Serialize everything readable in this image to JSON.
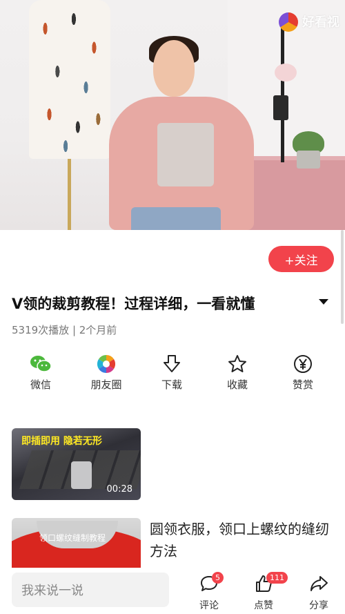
{
  "video": {
    "watermark_text": "好看视"
  },
  "follow_button": {
    "label": "+关注"
  },
  "video_info": {
    "title": "V领的裁剪教程！过程详细，一看就懂",
    "meta": "5319次播放 | 2个月前"
  },
  "share_actions": [
    {
      "label": "微信",
      "icon": "wechat-icon",
      "color": "#4cb83c"
    },
    {
      "label": "朋友圈",
      "icon": "moments-icon"
    },
    {
      "label": "下载",
      "icon": "download-icon"
    },
    {
      "label": "收藏",
      "icon": "favorite-star-icon"
    },
    {
      "label": "赞赏",
      "icon": "yen-icon"
    }
  ],
  "recommendations": [
    {
      "banner": "即插即用 隐若无形",
      "duration": "00:28",
      "title": ""
    },
    {
      "banner": "领口螺纹缝制教程",
      "title": "圆领衣服，领口上螺纹的缝纫方法"
    }
  ],
  "bottom_bar": {
    "comment_placeholder": "我来说一说",
    "comment": {
      "label": "评论",
      "count": "5"
    },
    "like": {
      "label": "点赞",
      "count": "111"
    },
    "share": {
      "label": "分享"
    }
  },
  "colors": {
    "accent": "#f2434b",
    "wechat": "#4cb83c",
    "banner_yellow": "#ffe923"
  }
}
